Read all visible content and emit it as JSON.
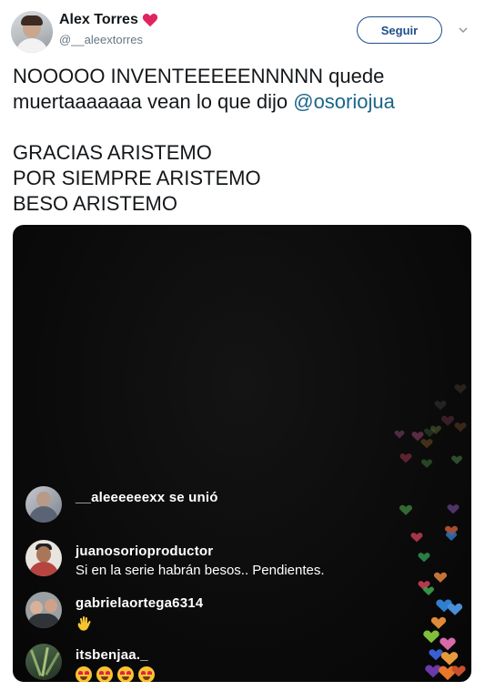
{
  "tweet": {
    "author_name": "Alex Torres",
    "author_handle": "@__aleextorres",
    "follow_label": "Seguir",
    "text_line1": "NOOOOO INVENTEEEEENNNNN quede",
    "text_line2_prefix": "muertaaaaaaa vean lo que dijo ",
    "mention": "@osoriojua",
    "text_line3": "GRACIAS ARISTEMO",
    "text_line4": "POR SIEMPRE ARISTEMO",
    "text_line5": "BESO ARISTEMO",
    "icons": {
      "name_badge": "red-heart-icon",
      "menu": "chevron-down-icon"
    },
    "colors": {
      "accent": "#1f4e8a",
      "mention": "#1b6589",
      "handle": "#657786"
    }
  },
  "live_video": {
    "comments": [
      {
        "user": "__aleeeeeexx se unió",
        "text": ""
      },
      {
        "user": "juanosorioproductor",
        "text": "Si en la serie habrán besos.. Pendientes."
      },
      {
        "user": "gabrielaortega6314",
        "text": "👋"
      },
      {
        "user": "itsbenjaa._",
        "text": "😍😍😍😍"
      }
    ],
    "reaction_icons": "floating-hearts"
  }
}
